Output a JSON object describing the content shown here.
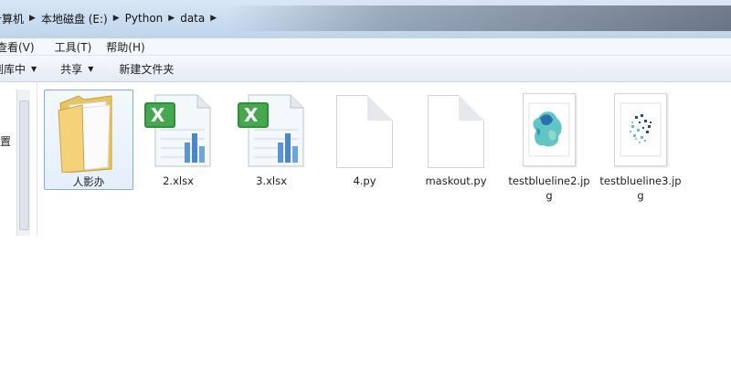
{
  "address": {
    "crumbs": [
      "计算机",
      "本地磁盘 (E:)",
      "Python",
      "data"
    ]
  },
  "menu": {
    "items": [
      "查看(V)",
      "工具(T)",
      "帮助(H)"
    ]
  },
  "commandbar": {
    "library": "包含到库中",
    "share": "共享",
    "new_folder": "新建文件夹"
  },
  "nav": {
    "visible_label": "位置"
  },
  "files": [
    {
      "name": "人影办",
      "type": "folder"
    },
    {
      "name": "2.xlsx",
      "type": "excel"
    },
    {
      "name": "3.xlsx",
      "type": "excel"
    },
    {
      "name": "4.py",
      "type": "blank"
    },
    {
      "name": "maskout.py",
      "type": "blank"
    },
    {
      "name": "testblueline2.jpg",
      "type": "image-map"
    },
    {
      "name": "testblueline3.jpg",
      "type": "image-scatter"
    }
  ],
  "colors": {
    "selection_border": "#84acdd",
    "excel_green": "#2f8f3a",
    "chart_blue": "#4a86c8",
    "folder_yellow": "#f3d27a"
  }
}
